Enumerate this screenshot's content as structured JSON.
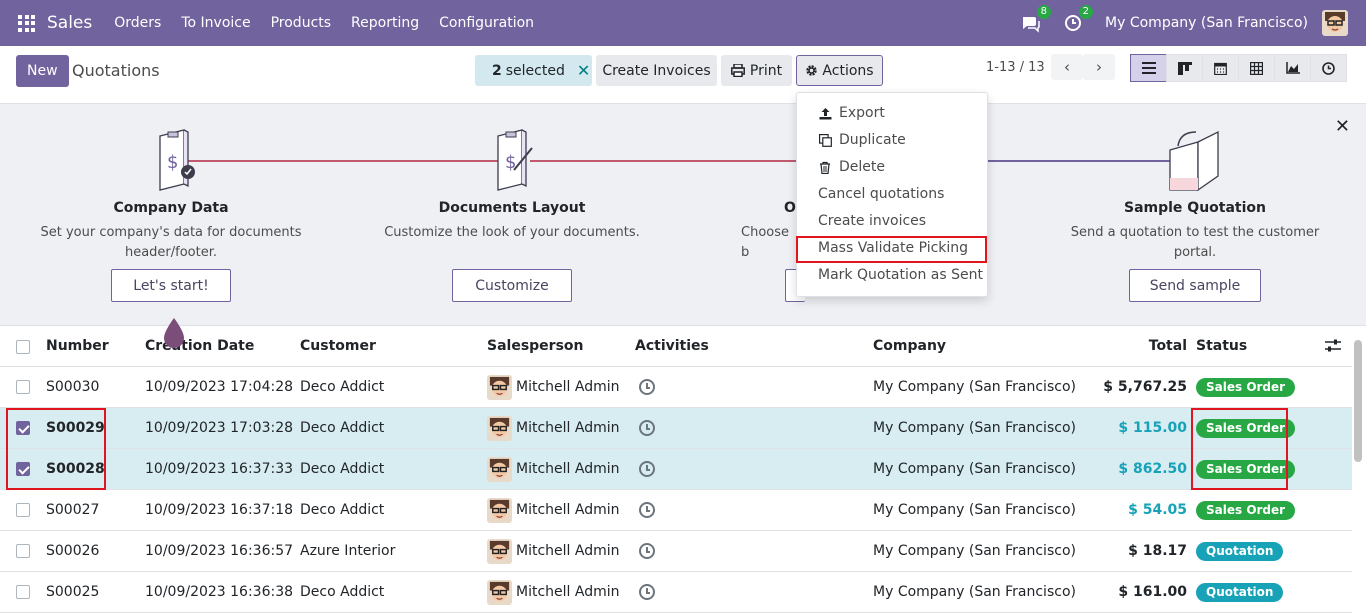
{
  "navbar": {
    "app_name": "Sales",
    "menu": [
      "Orders",
      "To Invoice",
      "Products",
      "Reporting",
      "Configuration"
    ],
    "messages_count": "8",
    "activities_count": "2",
    "company": "My Company (San Francisco)",
    "bg_color": "#71639e"
  },
  "control_panel": {
    "new_label": "New",
    "title": "Quotations",
    "selected_count": "2",
    "selected_label": "selected",
    "create_invoices_label": "Create Invoices",
    "print_label": "Print",
    "actions_label": "Actions",
    "pager": "1-13 / 13"
  },
  "onboarding": {
    "steps": [
      {
        "title": "Company Data",
        "desc": "Set your company's data for documents header/footer.",
        "button": "Let's start!"
      },
      {
        "title": "Documents Layout",
        "desc": "Customize the look of your documents.",
        "button": "Customize"
      },
      {
        "title": "O",
        "desc": "Choose b",
        "button": ""
      },
      {
        "title": "Sample Quotation",
        "desc": "Send a quotation to test the customer portal.",
        "button": "Send sample"
      }
    ]
  },
  "actions_menu": {
    "items": [
      {
        "label": "Export",
        "icon": "upload-icon"
      },
      {
        "label": "Duplicate",
        "icon": "copy-icon"
      },
      {
        "label": "Delete",
        "icon": "trash-icon"
      },
      {
        "label": "Cancel quotations",
        "icon": ""
      },
      {
        "label": "Create invoices",
        "icon": ""
      },
      {
        "label": "Mass Validate Picking",
        "icon": ""
      },
      {
        "label": "Mark Quotation as Sent",
        "icon": ""
      }
    ]
  },
  "table": {
    "headers": {
      "number": "Number",
      "creation_date": "Creation Date",
      "customer": "Customer",
      "salesperson": "Salesperson",
      "activities": "Activities",
      "company": "Company",
      "total": "Total",
      "status": "Status"
    },
    "rows": [
      {
        "number": "S00030",
        "date": "10/09/2023 17:04:28",
        "customer": "Deco Addict",
        "salesperson": "Mitchell Admin",
        "company": "My Company (San Francisco)",
        "total": "$ 5,767.25",
        "status": "Sales Order",
        "selected": false
      },
      {
        "number": "S00029",
        "date": "10/09/2023 17:03:28",
        "customer": "Deco Addict",
        "salesperson": "Mitchell Admin",
        "company": "My Company (San Francisco)",
        "total": "$ 115.00",
        "status": "Sales Order",
        "selected": true
      },
      {
        "number": "S00028",
        "date": "10/09/2023 16:37:33",
        "customer": "Deco Addict",
        "salesperson": "Mitchell Admin",
        "company": "My Company (San Francisco)",
        "total": "$ 862.50",
        "status": "Sales Order",
        "selected": true
      },
      {
        "number": "S00027",
        "date": "10/09/2023 16:37:18",
        "customer": "Deco Addict",
        "salesperson": "Mitchell Admin",
        "company": "My Company (San Francisco)",
        "total": "$ 54.05",
        "status": "Sales Order",
        "selected": false
      },
      {
        "number": "S00026",
        "date": "10/09/2023 16:36:57",
        "customer": "Azure Interior",
        "salesperson": "Mitchell Admin",
        "company": "My Company (San Francisco)",
        "total": "$ 18.17",
        "status": "Quotation",
        "selected": false
      },
      {
        "number": "S00025",
        "date": "10/09/2023 16:36:38",
        "customer": "Deco Addict",
        "salesperson": "Mitchell Admin",
        "company": "My Company (San Francisco)",
        "total": "$ 161.00",
        "status": "Quotation",
        "selected": false
      }
    ]
  }
}
